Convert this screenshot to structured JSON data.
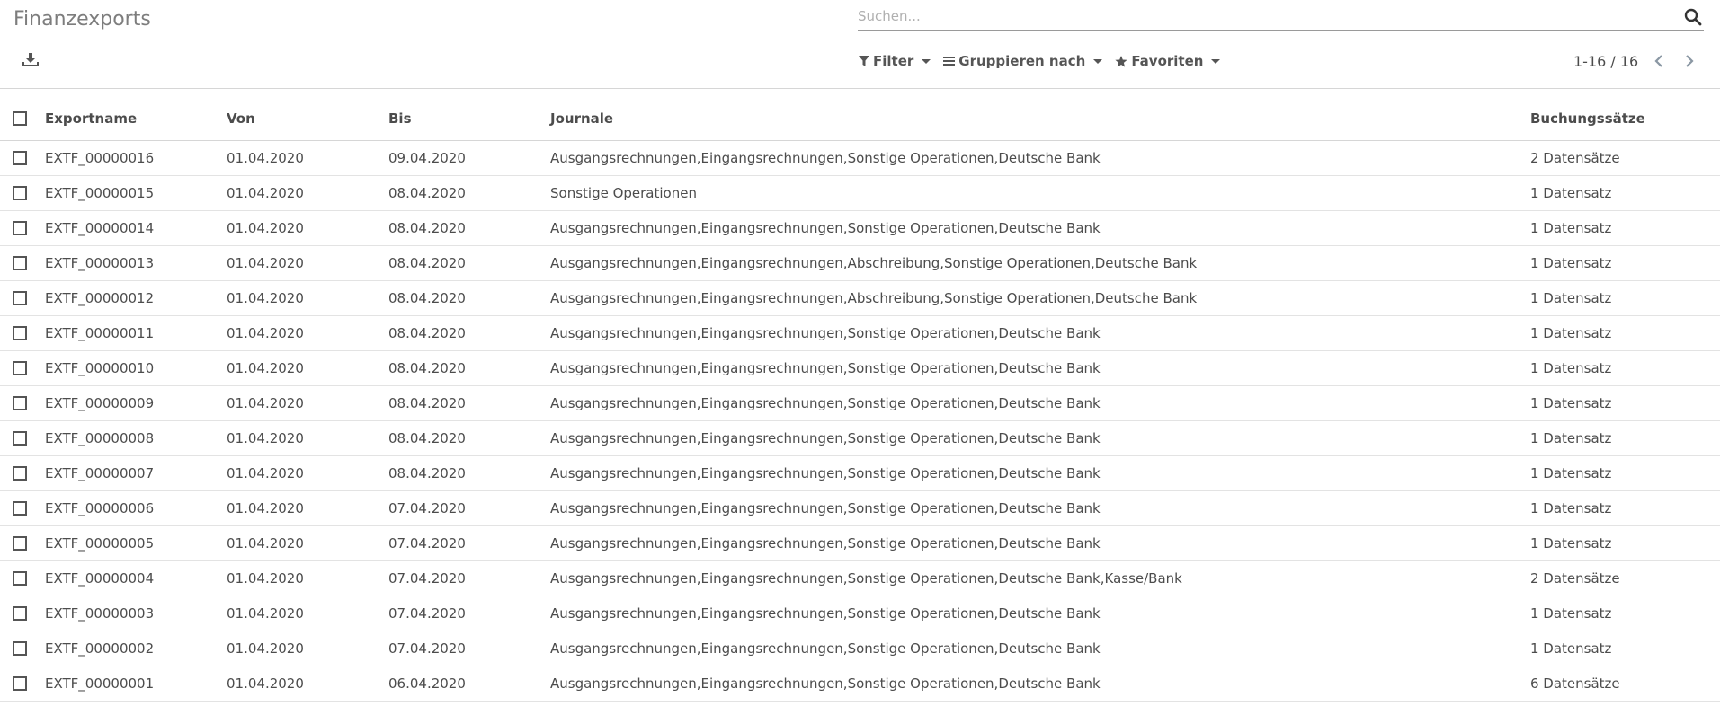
{
  "header": {
    "title": "Finanzexports"
  },
  "search": {
    "placeholder": "Suchen...",
    "value": ""
  },
  "menus": {
    "filter": "Filter",
    "group_by": "Gruppieren nach",
    "favorites": "Favoriten"
  },
  "pager": {
    "text": "1-16 / 16"
  },
  "table": {
    "columns": [
      "Exportname",
      "Von",
      "Bis",
      "Journale",
      "Buchungssätze"
    ],
    "rows": [
      {
        "name": "EXTF_00000016",
        "von": "01.04.2020",
        "bis": "09.04.2020",
        "journale": "Ausgangsrechnungen,Eingangsrechnungen,Sonstige Operationen,Deutsche Bank",
        "buchungen": "2 Datensätze"
      },
      {
        "name": "EXTF_00000015",
        "von": "01.04.2020",
        "bis": "08.04.2020",
        "journale": "Sonstige Operationen",
        "buchungen": "1 Datensatz"
      },
      {
        "name": "EXTF_00000014",
        "von": "01.04.2020",
        "bis": "08.04.2020",
        "journale": "Ausgangsrechnungen,Eingangsrechnungen,Sonstige Operationen,Deutsche Bank",
        "buchungen": "1 Datensatz"
      },
      {
        "name": "EXTF_00000013",
        "von": "01.04.2020",
        "bis": "08.04.2020",
        "journale": "Ausgangsrechnungen,Eingangsrechnungen,Abschreibung,Sonstige Operationen,Deutsche Bank",
        "buchungen": "1 Datensatz"
      },
      {
        "name": "EXTF_00000012",
        "von": "01.04.2020",
        "bis": "08.04.2020",
        "journale": "Ausgangsrechnungen,Eingangsrechnungen,Abschreibung,Sonstige Operationen,Deutsche Bank",
        "buchungen": "1 Datensatz"
      },
      {
        "name": "EXTF_00000011",
        "von": "01.04.2020",
        "bis": "08.04.2020",
        "journale": "Ausgangsrechnungen,Eingangsrechnungen,Sonstige Operationen,Deutsche Bank",
        "buchungen": "1 Datensatz"
      },
      {
        "name": "EXTF_00000010",
        "von": "01.04.2020",
        "bis": "08.04.2020",
        "journale": "Ausgangsrechnungen,Eingangsrechnungen,Sonstige Operationen,Deutsche Bank",
        "buchungen": "1 Datensatz"
      },
      {
        "name": "EXTF_00000009",
        "von": "01.04.2020",
        "bis": "08.04.2020",
        "journale": "Ausgangsrechnungen,Eingangsrechnungen,Sonstige Operationen,Deutsche Bank",
        "buchungen": "1 Datensatz"
      },
      {
        "name": "EXTF_00000008",
        "von": "01.04.2020",
        "bis": "08.04.2020",
        "journale": "Ausgangsrechnungen,Eingangsrechnungen,Sonstige Operationen,Deutsche Bank",
        "buchungen": "1 Datensatz"
      },
      {
        "name": "EXTF_00000007",
        "von": "01.04.2020",
        "bis": "08.04.2020",
        "journale": "Ausgangsrechnungen,Eingangsrechnungen,Sonstige Operationen,Deutsche Bank",
        "buchungen": "1 Datensatz"
      },
      {
        "name": "EXTF_00000006",
        "von": "01.04.2020",
        "bis": "07.04.2020",
        "journale": "Ausgangsrechnungen,Eingangsrechnungen,Sonstige Operationen,Deutsche Bank",
        "buchungen": "1 Datensatz"
      },
      {
        "name": "EXTF_00000005",
        "von": "01.04.2020",
        "bis": "07.04.2020",
        "journale": "Ausgangsrechnungen,Eingangsrechnungen,Sonstige Operationen,Deutsche Bank",
        "buchungen": "1 Datensatz"
      },
      {
        "name": "EXTF_00000004",
        "von": "01.04.2020",
        "bis": "07.04.2020",
        "journale": "Ausgangsrechnungen,Eingangsrechnungen,Sonstige Operationen,Deutsche Bank,Kasse/Bank",
        "buchungen": "2 Datensätze"
      },
      {
        "name": "EXTF_00000003",
        "von": "01.04.2020",
        "bis": "07.04.2020",
        "journale": "Ausgangsrechnungen,Eingangsrechnungen,Sonstige Operationen,Deutsche Bank",
        "buchungen": "1 Datensatz"
      },
      {
        "name": "EXTF_00000002",
        "von": "01.04.2020",
        "bis": "07.04.2020",
        "journale": "Ausgangsrechnungen,Eingangsrechnungen,Sonstige Operationen,Deutsche Bank",
        "buchungen": "1 Datensatz"
      },
      {
        "name": "EXTF_00000001",
        "von": "01.04.2020",
        "bis": "06.04.2020",
        "journale": "Ausgangsrechnungen,Eingangsrechnungen,Sonstige Operationen,Deutsche Bank",
        "buchungen": "6 Datensätze"
      }
    ]
  },
  "icons": {
    "search": "search-icon",
    "download": "download-icon",
    "filter": "filter-icon",
    "group_by": "bars-icon",
    "favorites": "star-icon",
    "prev": "chevron-left-icon",
    "next": "chevron-right-icon"
  }
}
